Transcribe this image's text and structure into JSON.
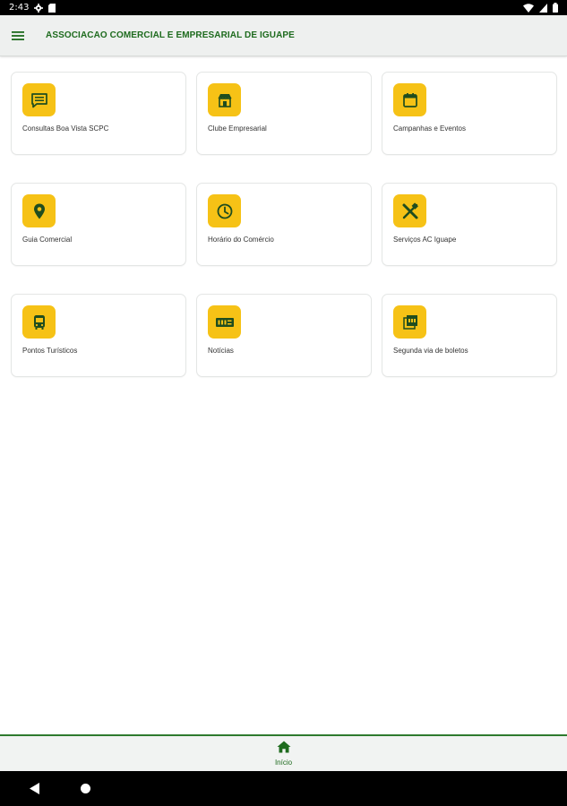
{
  "status_bar": {
    "time": "2:43",
    "icons": [
      "gear-icon",
      "sd-card-icon",
      "wifi-icon",
      "signal-icon",
      "battery-icon"
    ]
  },
  "app_bar": {
    "menu_icon": "hamburger-menu-icon",
    "title": "ASSOCIACAO COMERCIAL E EMPRESARIAL DE IGUAPE"
  },
  "colors": {
    "accent_green": "#1e6b1e",
    "icon_background": "#f6c216",
    "icon_foreground": "#1f4d1f"
  },
  "cards": [
    {
      "label": "Consultas Boa Vista SCPC",
      "icon": "message-box-icon"
    },
    {
      "label": "Clube Empresarial",
      "icon": "storefront-icon"
    },
    {
      "label": "Campanhas e Eventos",
      "icon": "calendar-icon"
    },
    {
      "label": "Guia Comercial",
      "icon": "map-pin-icon"
    },
    {
      "label": "Horário do Comércio",
      "icon": "clock-icon"
    },
    {
      "label": "Serviços AC Iguape",
      "icon": "tools-icon"
    },
    {
      "label": "Pontos Turísticos",
      "icon": "bus-icon"
    },
    {
      "label": "Notícias",
      "icon": "news-badge-icon"
    },
    {
      "label": "Segunda via de boletos",
      "icon": "pdf-document-icon"
    }
  ],
  "bottom_nav": {
    "home_label": "Início",
    "home_icon": "home-icon"
  },
  "system_nav": {
    "back_icon": "back-triangle-icon",
    "home_icon": "home-circle-icon"
  }
}
